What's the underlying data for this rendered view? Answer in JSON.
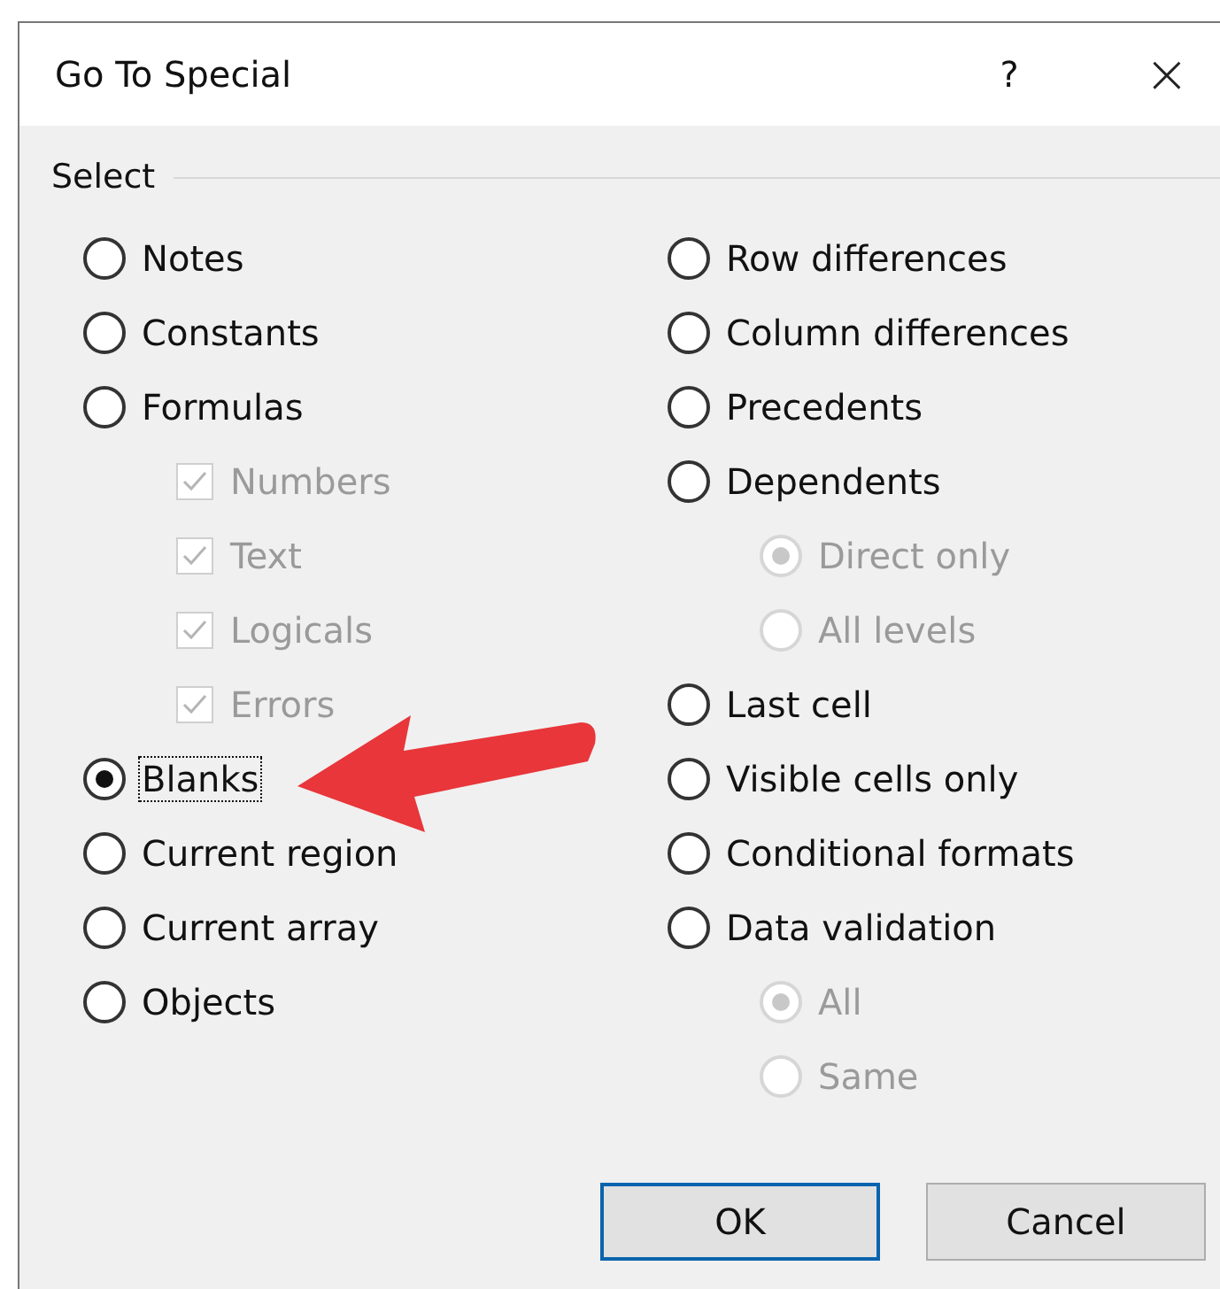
{
  "window": {
    "title": "Go To Special",
    "help": "?",
    "close": "×"
  },
  "group": {
    "label": "Select",
    "columns": [
      [
        {
          "kind": "radio",
          "label": "Notes",
          "selected": false,
          "disabled": false,
          "focused": false
        },
        {
          "kind": "radio",
          "label": "Constants",
          "selected": false,
          "disabled": false,
          "focused": false
        },
        {
          "kind": "radio",
          "label": "Formulas",
          "selected": false,
          "disabled": false,
          "focused": false
        },
        {
          "kind": "checkbox",
          "label": "Numbers",
          "checked": true,
          "disabled": true
        },
        {
          "kind": "checkbox",
          "label": "Text",
          "checked": true,
          "disabled": true
        },
        {
          "kind": "checkbox",
          "label": "Logicals",
          "checked": true,
          "disabled": true
        },
        {
          "kind": "checkbox",
          "label": "Errors",
          "checked": true,
          "disabled": true
        },
        {
          "kind": "radio",
          "label": "Blanks",
          "selected": true,
          "disabled": false,
          "focused": true
        },
        {
          "kind": "radio",
          "label": "Current region",
          "selected": false,
          "disabled": false,
          "focused": false
        },
        {
          "kind": "radio",
          "label": "Current array",
          "selected": false,
          "disabled": false,
          "focused": false
        },
        {
          "kind": "radio",
          "label": "Objects",
          "selected": false,
          "disabled": false,
          "focused": false
        }
      ],
      [
        {
          "kind": "radio",
          "label": "Row differences",
          "selected": false,
          "disabled": false,
          "focused": false
        },
        {
          "kind": "radio",
          "label": "Column differences",
          "selected": false,
          "disabled": false,
          "focused": false
        },
        {
          "kind": "radio",
          "label": "Precedents",
          "selected": false,
          "disabled": false,
          "focused": false
        },
        {
          "kind": "radio",
          "label": "Dependents",
          "selected": false,
          "disabled": false,
          "focused": false
        },
        {
          "kind": "subradio",
          "label": "Direct only",
          "selected": true,
          "disabled": true,
          "focused": false
        },
        {
          "kind": "subradio",
          "label": "All levels",
          "selected": false,
          "disabled": true,
          "focused": false
        },
        {
          "kind": "radio",
          "label": "Last cell",
          "selected": false,
          "disabled": false,
          "focused": false
        },
        {
          "kind": "radio",
          "label": "Visible cells only",
          "selected": false,
          "disabled": false,
          "focused": false
        },
        {
          "kind": "radio",
          "label": "Conditional formats",
          "selected": false,
          "disabled": false,
          "focused": false
        },
        {
          "kind": "radio",
          "label": "Data validation",
          "selected": false,
          "disabled": false,
          "focused": false
        },
        {
          "kind": "subradio",
          "label": "All",
          "selected": true,
          "disabled": true,
          "focused": false
        },
        {
          "kind": "subradio",
          "label": "Same",
          "selected": false,
          "disabled": true,
          "focused": false
        }
      ]
    ]
  },
  "buttons": [
    {
      "label": "OK",
      "default": true
    },
    {
      "label": "Cancel",
      "default": false
    }
  ]
}
